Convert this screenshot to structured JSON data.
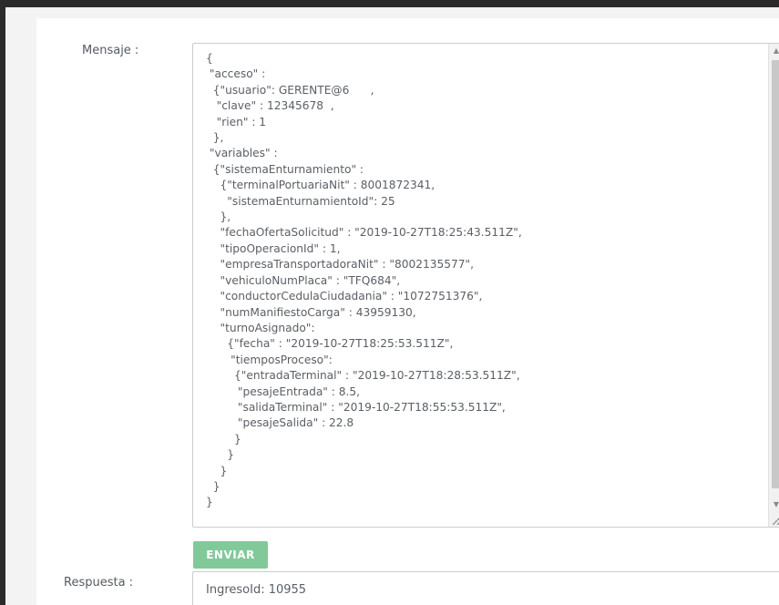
{
  "form": {
    "mensaje_label": "Mensaje :",
    "mensaje_value": "{\n \"acceso\" :\n  {\"usuario\": GERENTE@6      ,\n   \"clave\" : 12345678  ,\n   \"rien\" : 1\n  },\n \"variables\" :\n  {\"sistemaEnturnamiento\" :\n    {\"terminalPortuariaNit\" : 8001872341,\n      \"sistemaEnturnamientoId\": 25\n    },\n    \"fechaOfertaSolicitud\" : \"2019-10-27T18:25:43.511Z\",\n    \"tipoOperacionId\" : 1,\n    \"empresaTransportadoraNit\" : \"8002135577\",\n    \"vehiculoNumPlaca\" : \"TFQ684\",\n    \"conductorCedulaCiudadania\" : \"1072751376\",\n    \"numManifiestoCarga\" : 43959130,\n    \"turnoAsignado\":\n      {\"fecha\" : \"2019-10-27T18:25:53.511Z\",\n       \"tiemposProceso\":\n        {\"entradaTerminal\" : \"2019-10-27T18:28:53.511Z\",\n         \"pesajeEntrada\" : 8.5,\n         \"salidaTerminal\" : \"2019-10-27T18:55:53.511Z\",\n         \"pesajeSalida\" : 22.8\n        }\n      }\n    }\n  }\n}",
    "enviar_label": "ENVIAR",
    "respuesta_label": "Respuesta :",
    "respuesta_value": "IngresoId: 10955"
  },
  "colors": {
    "button_bg": "#82c99a",
    "text": "#5a5f66",
    "border": "#c9cdd2"
  },
  "icons": {
    "scroll_up": "scroll-up-arrow-icon",
    "scroll_down": "scroll-down-arrow-icon",
    "resize": "resize-grip-icon"
  }
}
